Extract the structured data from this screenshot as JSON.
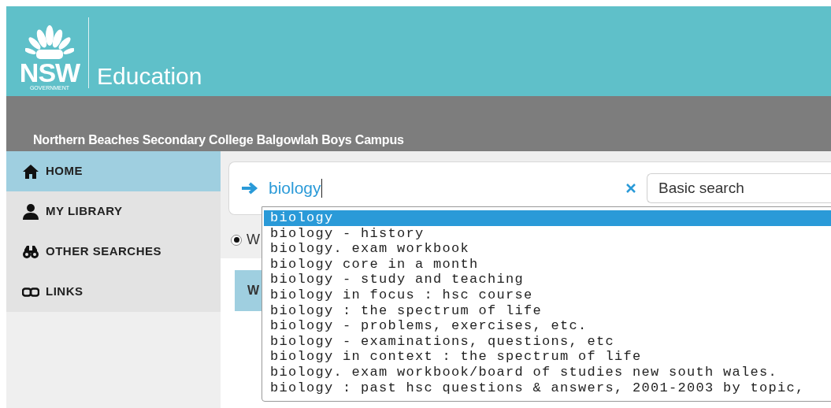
{
  "header": {
    "logo_text": "NSW",
    "logo_subtext": "GOVERNMENT",
    "title": "Education"
  },
  "school_name": "Northern Beaches Secondary College Balgowlah Boys Campus",
  "sidebar": {
    "items": [
      {
        "label": "HOME",
        "kind": "home",
        "selected": true
      },
      {
        "label": "MY LIBRARY",
        "kind": "person",
        "selected": false
      },
      {
        "label": "OTHER SEARCHES",
        "kind": "binoculars",
        "selected": false
      },
      {
        "label": "LINKS",
        "kind": "link",
        "selected": false
      }
    ]
  },
  "search": {
    "value": "biology",
    "mode": "Basic search"
  },
  "radio": {
    "label": "W",
    "selected": true
  },
  "tab": {
    "label": "W"
  },
  "suggestions": [
    {
      "text": "biology",
      "selected": true
    },
    {
      "text": "biology - history",
      "selected": false
    },
    {
      "text": "biology. exam workbook",
      "selected": false
    },
    {
      "text": "biology core in a month",
      "selected": false
    },
    {
      "text": "biology - study and teaching",
      "selected": false
    },
    {
      "text": "biology in focus : hsc course",
      "selected": false
    },
    {
      "text": "biology : the spectrum of life",
      "selected": false
    },
    {
      "text": "biology - problems, exercises, etc.",
      "selected": false
    },
    {
      "text": "biology - examinations, questions, etc",
      "selected": false
    },
    {
      "text": "biology in context : the spectrum of life",
      "selected": false
    },
    {
      "text": "biology. exam workbook/board of studies new south wales.",
      "selected": false
    },
    {
      "text": "biology : past hsc questions & answers, 2001-2003 by topic,",
      "selected": false
    }
  ]
}
